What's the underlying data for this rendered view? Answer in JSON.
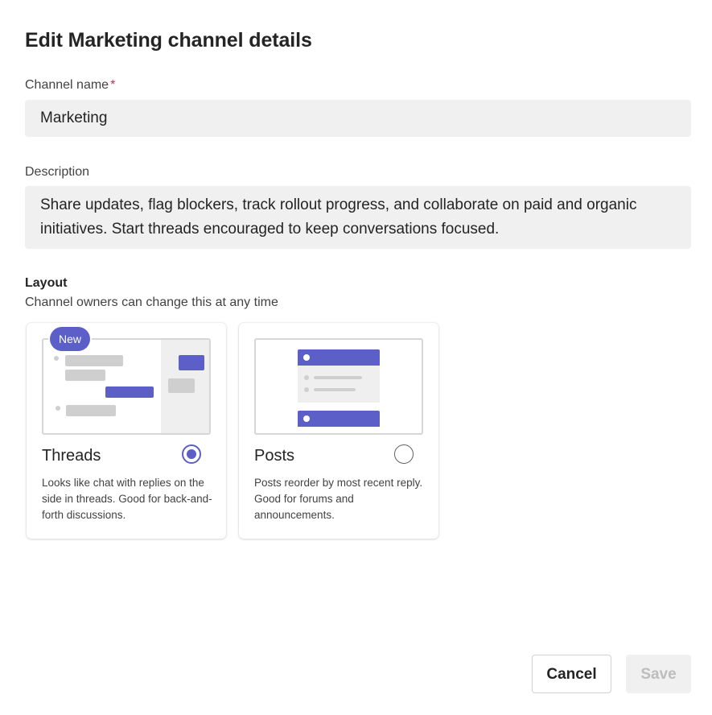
{
  "dialog": {
    "title": "Edit Marketing channel details"
  },
  "channel_name": {
    "label": "Channel name",
    "required_mark": "*",
    "value": "Marketing"
  },
  "description": {
    "label": "Description",
    "value": "Share updates, flag blockers, track rollout progress, and collaborate on paid and organic initiatives. Start threads encouraged to keep conversations focused."
  },
  "layout": {
    "title": "Layout",
    "subtitle": "Channel owners can change this at any time",
    "options": [
      {
        "title": "Threads",
        "badge": "New",
        "description": "Looks like chat with replies on the side in threads. Good for back-and-forth discussions.",
        "selected": true,
        "icon": "radio-checked-icon"
      },
      {
        "title": "Posts",
        "description": "Posts reorder by most recent reply. Good for forums and announcements.",
        "selected": false,
        "icon": "radio-unchecked-icon"
      }
    ]
  },
  "footer": {
    "cancel_label": "Cancel",
    "save_label": "Save"
  },
  "colors": {
    "accent": "#5b5fc7",
    "required": "#c4314b",
    "input_bg": "#f0f0f0",
    "disabled_text": "#bdbdbd"
  }
}
